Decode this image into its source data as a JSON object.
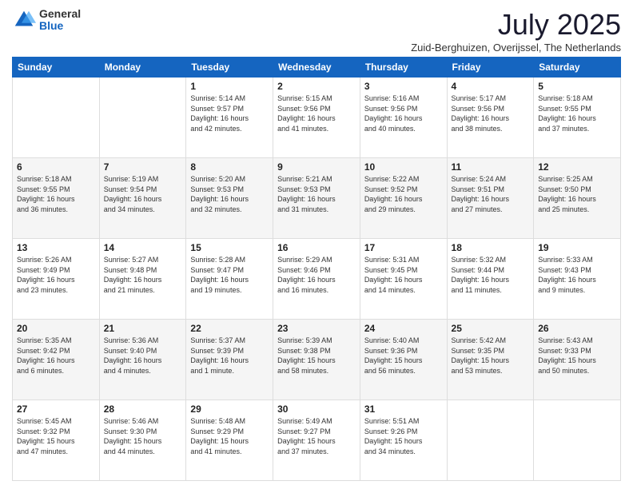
{
  "logo": {
    "general": "General",
    "blue": "Blue"
  },
  "title": "July 2025",
  "location": "Zuid-Berghuizen, Overijssel, The Netherlands",
  "days_of_week": [
    "Sunday",
    "Monday",
    "Tuesday",
    "Wednesday",
    "Thursday",
    "Friday",
    "Saturday"
  ],
  "weeks": [
    [
      {
        "day": "",
        "info": ""
      },
      {
        "day": "",
        "info": ""
      },
      {
        "day": "1",
        "info": "Sunrise: 5:14 AM\nSunset: 9:57 PM\nDaylight: 16 hours\nand 42 minutes."
      },
      {
        "day": "2",
        "info": "Sunrise: 5:15 AM\nSunset: 9:56 PM\nDaylight: 16 hours\nand 41 minutes."
      },
      {
        "day": "3",
        "info": "Sunrise: 5:16 AM\nSunset: 9:56 PM\nDaylight: 16 hours\nand 40 minutes."
      },
      {
        "day": "4",
        "info": "Sunrise: 5:17 AM\nSunset: 9:56 PM\nDaylight: 16 hours\nand 38 minutes."
      },
      {
        "day": "5",
        "info": "Sunrise: 5:18 AM\nSunset: 9:55 PM\nDaylight: 16 hours\nand 37 minutes."
      }
    ],
    [
      {
        "day": "6",
        "info": "Sunrise: 5:18 AM\nSunset: 9:55 PM\nDaylight: 16 hours\nand 36 minutes."
      },
      {
        "day": "7",
        "info": "Sunrise: 5:19 AM\nSunset: 9:54 PM\nDaylight: 16 hours\nand 34 minutes."
      },
      {
        "day": "8",
        "info": "Sunrise: 5:20 AM\nSunset: 9:53 PM\nDaylight: 16 hours\nand 32 minutes."
      },
      {
        "day": "9",
        "info": "Sunrise: 5:21 AM\nSunset: 9:53 PM\nDaylight: 16 hours\nand 31 minutes."
      },
      {
        "day": "10",
        "info": "Sunrise: 5:22 AM\nSunset: 9:52 PM\nDaylight: 16 hours\nand 29 minutes."
      },
      {
        "day": "11",
        "info": "Sunrise: 5:24 AM\nSunset: 9:51 PM\nDaylight: 16 hours\nand 27 minutes."
      },
      {
        "day": "12",
        "info": "Sunrise: 5:25 AM\nSunset: 9:50 PM\nDaylight: 16 hours\nand 25 minutes."
      }
    ],
    [
      {
        "day": "13",
        "info": "Sunrise: 5:26 AM\nSunset: 9:49 PM\nDaylight: 16 hours\nand 23 minutes."
      },
      {
        "day": "14",
        "info": "Sunrise: 5:27 AM\nSunset: 9:48 PM\nDaylight: 16 hours\nand 21 minutes."
      },
      {
        "day": "15",
        "info": "Sunrise: 5:28 AM\nSunset: 9:47 PM\nDaylight: 16 hours\nand 19 minutes."
      },
      {
        "day": "16",
        "info": "Sunrise: 5:29 AM\nSunset: 9:46 PM\nDaylight: 16 hours\nand 16 minutes."
      },
      {
        "day": "17",
        "info": "Sunrise: 5:31 AM\nSunset: 9:45 PM\nDaylight: 16 hours\nand 14 minutes."
      },
      {
        "day": "18",
        "info": "Sunrise: 5:32 AM\nSunset: 9:44 PM\nDaylight: 16 hours\nand 11 minutes."
      },
      {
        "day": "19",
        "info": "Sunrise: 5:33 AM\nSunset: 9:43 PM\nDaylight: 16 hours\nand 9 minutes."
      }
    ],
    [
      {
        "day": "20",
        "info": "Sunrise: 5:35 AM\nSunset: 9:42 PM\nDaylight: 16 hours\nand 6 minutes."
      },
      {
        "day": "21",
        "info": "Sunrise: 5:36 AM\nSunset: 9:40 PM\nDaylight: 16 hours\nand 4 minutes."
      },
      {
        "day": "22",
        "info": "Sunrise: 5:37 AM\nSunset: 9:39 PM\nDaylight: 16 hours\nand 1 minute."
      },
      {
        "day": "23",
        "info": "Sunrise: 5:39 AM\nSunset: 9:38 PM\nDaylight: 15 hours\nand 58 minutes."
      },
      {
        "day": "24",
        "info": "Sunrise: 5:40 AM\nSunset: 9:36 PM\nDaylight: 15 hours\nand 56 minutes."
      },
      {
        "day": "25",
        "info": "Sunrise: 5:42 AM\nSunset: 9:35 PM\nDaylight: 15 hours\nand 53 minutes."
      },
      {
        "day": "26",
        "info": "Sunrise: 5:43 AM\nSunset: 9:33 PM\nDaylight: 15 hours\nand 50 minutes."
      }
    ],
    [
      {
        "day": "27",
        "info": "Sunrise: 5:45 AM\nSunset: 9:32 PM\nDaylight: 15 hours\nand 47 minutes."
      },
      {
        "day": "28",
        "info": "Sunrise: 5:46 AM\nSunset: 9:30 PM\nDaylight: 15 hours\nand 44 minutes."
      },
      {
        "day": "29",
        "info": "Sunrise: 5:48 AM\nSunset: 9:29 PM\nDaylight: 15 hours\nand 41 minutes."
      },
      {
        "day": "30",
        "info": "Sunrise: 5:49 AM\nSunset: 9:27 PM\nDaylight: 15 hours\nand 37 minutes."
      },
      {
        "day": "31",
        "info": "Sunrise: 5:51 AM\nSunset: 9:26 PM\nDaylight: 15 hours\nand 34 minutes."
      },
      {
        "day": "",
        "info": ""
      },
      {
        "day": "",
        "info": ""
      }
    ]
  ]
}
